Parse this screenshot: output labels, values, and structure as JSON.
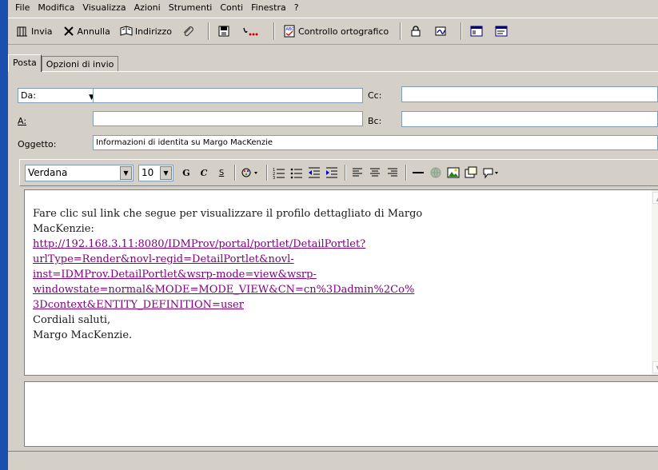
{
  "menubar": {
    "items": [
      "File",
      "Modifica",
      "Visualizza",
      "Azioni",
      "Strumenti",
      "Conti",
      "Finestra",
      "?"
    ]
  },
  "toolbar": {
    "send_label": "Invia",
    "cancel_label": "Annulla",
    "address_label": "Indirizzo",
    "spellcheck_label": "Controllo ortografico"
  },
  "tabs": [
    "Posta",
    "Opzioni di invio"
  ],
  "address": {
    "from_selector": "Da:",
    "from_value": "",
    "to_label": "A:",
    "to_value": "",
    "cc_label": "Cc:",
    "cc_value": "",
    "bcc_label": "Bc:",
    "bcc_value": "",
    "subject_label": "Oggetto:",
    "subject_value": "Informazioni di identita  su Margo MacKenzie"
  },
  "format": {
    "font": "Verdana",
    "size": "10",
    "bold_glyph": "G",
    "italic_glyph": "C",
    "underline_glyph": "S"
  },
  "message": {
    "intro": "Fare clic sul link che segue per visualizzare il profilo dettagliato di Margo",
    "intro_cont": "MacKenzie:",
    "link_lines": [
      "http://192.168.3.11:8080/IDMProv/portal/portlet/DetailPortlet?",
      "urlType=Render&novl-regid=DetailPortlet&novl-",
      "inst=IDMProv.DetailPortlet&wsrp-mode=view&wsrp-",
      "windowstate=normal&MODE=MODE_VIEW&CN=cn%3Dadmin%2Co%",
      "3Dcontext&ENTITY_DEFINITION=user"
    ],
    "closing": "Cordiali saluti,",
    "signature": "Margo MacKenzie."
  }
}
